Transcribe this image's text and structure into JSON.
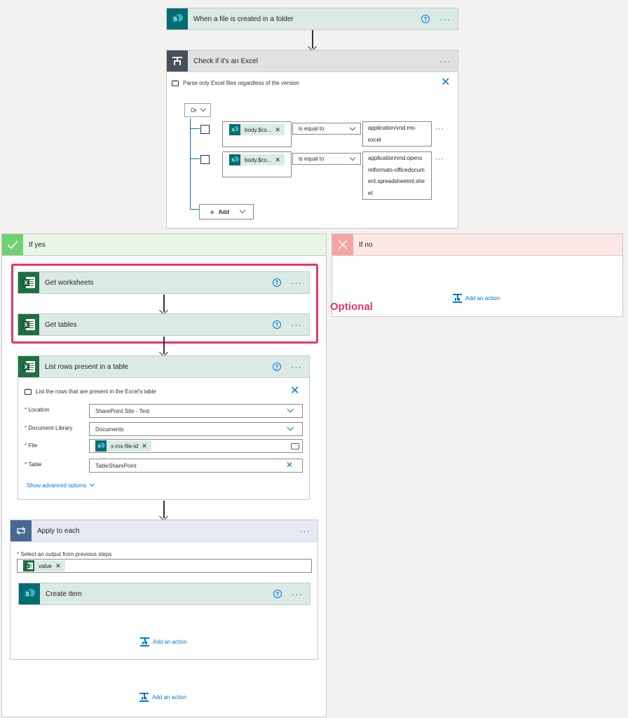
{
  "trigger": {
    "title": "When a file is created in a folder"
  },
  "condition": {
    "title": "Check if it's an Excel",
    "description": "Parse only Excel files regardless of the version",
    "group_operator": "Or",
    "rows": [
      {
        "token": "body.$co...",
        "operator": "is equal to",
        "value": "application/vnd.ms-excel"
      },
      {
        "token": "body.$co...",
        "operator": "is equal to",
        "value": "application/vnd.openxmlformats-officedocument.spreadsheetml.sheet"
      }
    ],
    "add_label": "Add"
  },
  "if_yes": {
    "title": "If yes",
    "optional_label": "Optional",
    "get_worksheets": "Get worksheets",
    "get_tables": "Get tables",
    "list_rows": {
      "title": "List rows present in a table",
      "description": "List the rows that are present in the Excel's table",
      "location_label": "Location",
      "location_value": "SharePoint Site - Test",
      "library_label": "Document Library",
      "library_value": "Documents",
      "file_label": "File",
      "file_token": "x-ms-file-id",
      "table_label": "Table",
      "table_value": "TableSharePoint",
      "advanced": "Show advanced options"
    },
    "apply_each": {
      "title": "Apply to each",
      "select_label": "Select an output from previous steps",
      "token": "value",
      "create_item": "Create item",
      "add_action": "Add an action"
    },
    "add_action": "Add an action"
  },
  "if_no": {
    "title": "If no",
    "add_action": "Add an action"
  },
  "colors": {
    "accent": "#0078d4",
    "highlight": "#e3356f",
    "yes_bg": "#e7f6e7",
    "no_bg": "#fde7e7"
  }
}
